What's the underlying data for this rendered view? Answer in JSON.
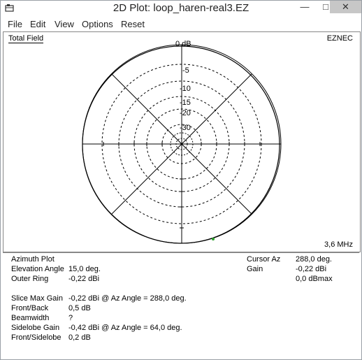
{
  "window": {
    "title": "2D Plot: loop_haren-real3.EZ"
  },
  "menu": [
    "File",
    "Edit",
    "View",
    "Options",
    "Reset"
  ],
  "plot": {
    "title": "Total Field",
    "brand": "EZNEC",
    "frequency": "3,6 MHz",
    "ring_labels": [
      "0 dB",
      "-5",
      "-10",
      "-15",
      "-20",
      "-30"
    ]
  },
  "info": {
    "plot_type": "Azimuth Plot",
    "elevation": {
      "label": "Elevation Angle",
      "value": "15,0 deg."
    },
    "outer_ring": {
      "label": "Outer Ring",
      "value": "-0,22 dBi"
    },
    "slice_max_gain": {
      "label": "Slice Max Gain",
      "value": "-0,22 dBi @ Az Angle = 288,0 deg."
    },
    "front_back": {
      "label": "Front/Back",
      "value": "0,5 dB"
    },
    "beamwidth": {
      "label": "Beamwidth",
      "value": "?"
    },
    "sidelobe_gain": {
      "label": "Sidelobe Gain",
      "value": "-0,42 dBi @ Az Angle = 64,0 deg."
    },
    "front_sidelobe": {
      "label": "Front/Sidelobe",
      "value": "0,2 dB"
    },
    "cursor_az": {
      "label": "Cursor Az",
      "value": "288,0 deg."
    },
    "gain": {
      "label": "Gain",
      "value": "-0,22 dBi"
    },
    "dbmax": "0,0 dBmax"
  }
}
